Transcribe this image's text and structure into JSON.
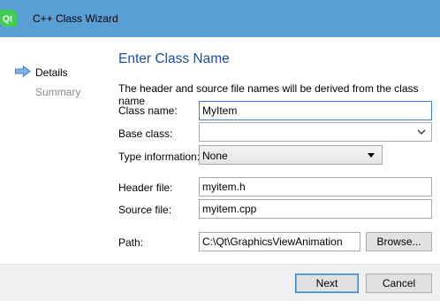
{
  "window": {
    "title": "C++ Class Wizard"
  },
  "steps": [
    {
      "label": "Details",
      "active": true
    },
    {
      "label": "Summary",
      "active": false
    }
  ],
  "page": {
    "title": "Enter Class Name",
    "description": "The header and source file names will be derived from the class name"
  },
  "form": {
    "class_name": {
      "label": "Class name:",
      "value": "MyItem"
    },
    "base_class": {
      "label": "Base class:",
      "value": ""
    },
    "type_info": {
      "label": "Type information:",
      "value": "None"
    },
    "header_file": {
      "label": "Header file:",
      "value": "myitem.h"
    },
    "source_file": {
      "label": "Source file:",
      "value": "myitem.cpp"
    },
    "path": {
      "label": "Path:",
      "value": "C:\\Qt\\GraphicsViewAnimation"
    }
  },
  "buttons": {
    "browse": "Browse...",
    "next": "Next",
    "cancel": "Cancel"
  },
  "colors": {
    "titlebar": "#5a9fd4",
    "heading": "#1c4f9e",
    "step_arrow": "#3c7fd1",
    "qt_logo": "#41cd52"
  },
  "icons": {
    "app": "qt-logo-icon",
    "step_marker": "arrow-right-icon",
    "combo_dropdown": "chevron-down-icon",
    "select_dropdown": "triangle-down-icon"
  }
}
